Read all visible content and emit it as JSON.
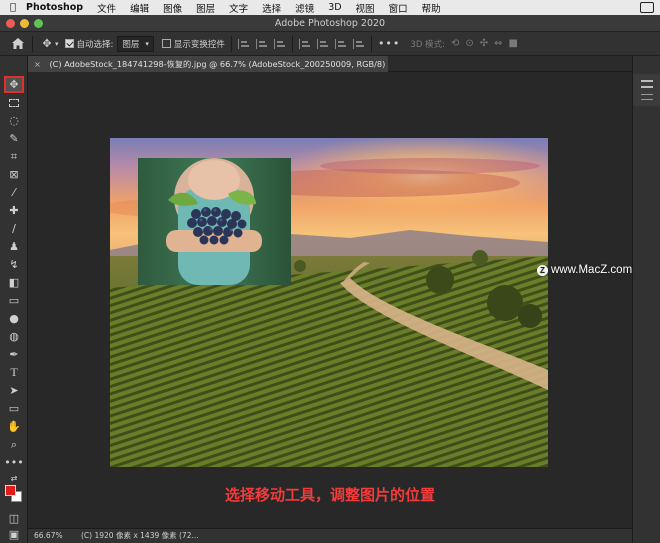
{
  "menubar": {
    "app_name": "Photoshop",
    "items": [
      "文件",
      "编辑",
      "图像",
      "图层",
      "文字",
      "选择",
      "滤镜",
      "3D",
      "视图",
      "窗口",
      "帮助"
    ]
  },
  "window": {
    "title": "Adobe Photoshop 2020"
  },
  "options": {
    "auto_select_label": "自动选择:",
    "auto_select_value": "图层",
    "show_transform_label": "显示变换控件",
    "mode_3d_label": "3D 模式:"
  },
  "document": {
    "tab_close": "×",
    "tab_title": "(C) AdobeStock_184741298-恢复的.jpg @ 66.7% (AdobeStock_200250009, RGB/8) *"
  },
  "status": {
    "zoom": "66.67%",
    "info": "(C) 1920 像素 x 1439 像素 (72..."
  },
  "overlay": {
    "caption": "选择移动工具，调整图片的位置",
    "watermark": "www.MacZ.com",
    "watermark_badge": "Z"
  },
  "colors": {
    "foreground": "#e21b1b",
    "background": "#ffffff",
    "caption": "#f23b3b",
    "active_tool_border": "#e0302a"
  },
  "tools": [
    "move-tool-icon",
    "marquee-tool-icon",
    "lasso-tool-icon",
    "quick-select-tool-icon",
    "crop-tool-icon",
    "frame-tool-icon",
    "eyedropper-tool-icon",
    "healing-brush-icon",
    "brush-tool-icon",
    "clone-stamp-icon",
    "history-brush-icon",
    "eraser-tool-icon",
    "gradient-tool-icon",
    "blur-tool-icon",
    "dodge-tool-icon",
    "pen-tool-icon",
    "type-tool-icon",
    "path-select-icon",
    "rectangle-tool-icon",
    "hand-tool-icon",
    "zoom-tool-icon",
    "more-tools-icon"
  ]
}
